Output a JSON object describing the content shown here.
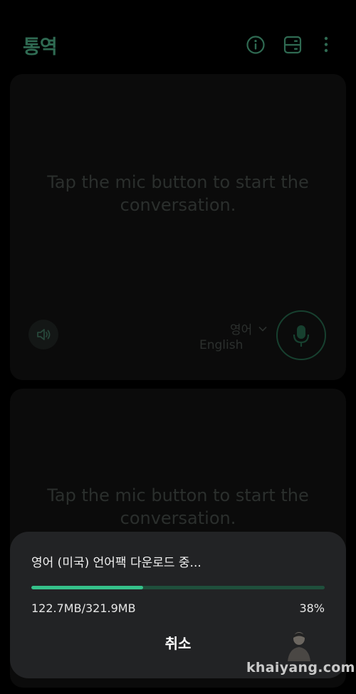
{
  "header": {
    "title": "통역",
    "icons": [
      "info-icon",
      "split-screen-icon",
      "more-options-icon"
    ]
  },
  "speaker_top": {
    "prompt": "Tap the mic button to start the conversation.",
    "language_native": "영어",
    "language_english": "English"
  },
  "speaker_bottom": {
    "prompt": "Tap the mic button to start the conversation."
  },
  "download_sheet": {
    "title": "영어 (미국) 언어팩 다운로드 중...",
    "progress_fraction": 0.38,
    "size_text": "122.7MB/321.9MB",
    "percent_text": "38%",
    "cancel_label": "취소"
  },
  "watermark": "khaiyang.com",
  "colors": {
    "accent": "#35c18a",
    "title_green": "#2f6a52",
    "sheet_bg": "#222325"
  }
}
